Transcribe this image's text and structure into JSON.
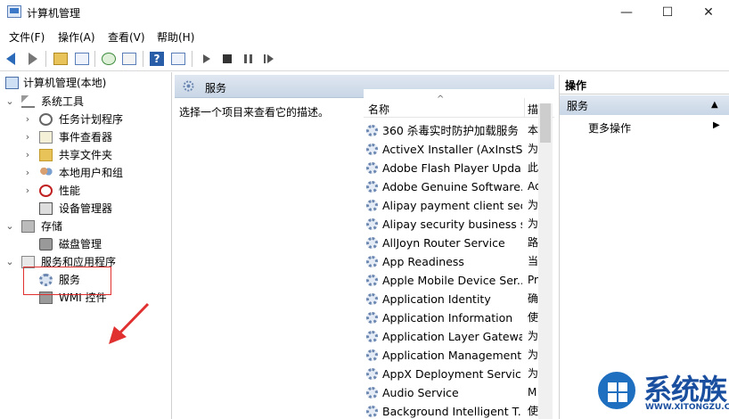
{
  "window": {
    "title": "计算机管理",
    "minimize": "—",
    "maximize": "☐",
    "close": "✕"
  },
  "menu": [
    "文件(F)",
    "操作(A)",
    "查看(V)",
    "帮助(H)"
  ],
  "tree": {
    "root": "计算机管理(本地)",
    "system_tools": "系统工具",
    "task_scheduler": "任务计划程序",
    "event_viewer": "事件查看器",
    "shared_folders": "共享文件夹",
    "local_users": "本地用户和组",
    "performance": "性能",
    "device_manager": "设备管理器",
    "storage": "存储",
    "disk_management": "磁盘管理",
    "services_apps": "服务和应用程序",
    "services": "服务",
    "wmi": "WMI 控件"
  },
  "center": {
    "header": "服务",
    "description_hint": "选择一个项目来查看它的描述。",
    "col_name": "名称",
    "col_desc": "描"
  },
  "services": [
    {
      "name": "360 杀毒实时防护加载服务",
      "desc": "本"
    },
    {
      "name": "ActiveX Installer (AxInstSV)",
      "desc": "为"
    },
    {
      "name": "Adobe Flash Player Upda...",
      "desc": "此"
    },
    {
      "name": "Adobe Genuine Software...",
      "desc": "Ac"
    },
    {
      "name": "Alipay payment client sec...",
      "desc": "为"
    },
    {
      "name": "Alipay security business s...",
      "desc": "为"
    },
    {
      "name": "AllJoyn Router Service",
      "desc": "路"
    },
    {
      "name": "App Readiness",
      "desc": "当"
    },
    {
      "name": "Apple Mobile Device Ser...",
      "desc": "Pr"
    },
    {
      "name": "Application Identity",
      "desc": "确"
    },
    {
      "name": "Application Information",
      "desc": "使"
    },
    {
      "name": "Application Layer Gatewa...",
      "desc": "为"
    },
    {
      "name": "Application Management",
      "desc": "为"
    },
    {
      "name": "AppX Deployment Servic...",
      "desc": "为"
    },
    {
      "name": "Audio Service",
      "desc": "M"
    },
    {
      "name": "Background Intelligent T...",
      "desc": "使"
    }
  ],
  "actions": {
    "header": "操作",
    "section": "服务",
    "more": "更多操作"
  },
  "watermark": {
    "brand": "系统族",
    "url": "WWW.XITONGZU.COM"
  },
  "colors": {
    "annotation": "#e03030",
    "pane_header": "#c9d6e6",
    "brand": "#1a4fa0"
  }
}
